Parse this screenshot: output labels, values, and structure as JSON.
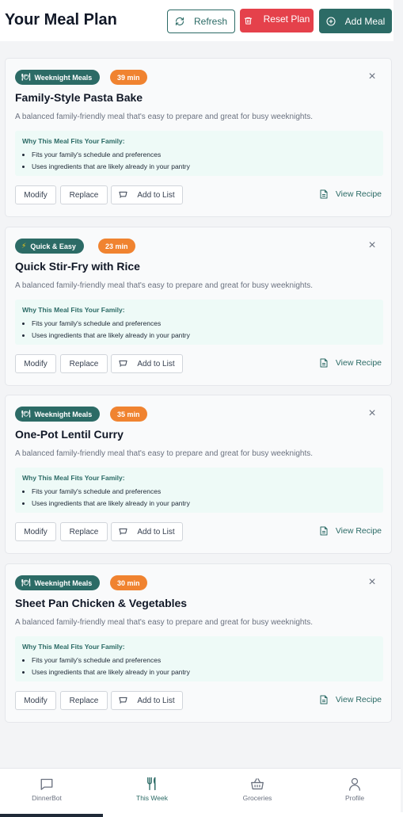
{
  "header": {
    "title": "Your Meal Plan",
    "refresh_label": "Refresh",
    "reset_label": "Reset Plan",
    "add_label": "Add Meal"
  },
  "colors": {
    "primary": "#2c6b66",
    "danger": "#e5414b",
    "time_badge": "#f08330",
    "why_bg": "#eefaf7"
  },
  "meals": [
    {
      "category": "Weeknight Meals",
      "category_icon": "plate-icon",
      "time": "39 min",
      "title": "Family-Style Pasta Bake",
      "description": "A balanced family-friendly meal that's easy to prepare and great for busy weeknights.",
      "why_title": "Why This Meal Fits Your Family:",
      "reasons": [
        "Fits your family's schedule and preferences",
        "Uses ingredients that are likely already in your pantry"
      ],
      "modify_label": "Modify",
      "replace_label": "Replace",
      "add_to_list_label": "Add to List",
      "view_recipe_label": "View Recipe"
    },
    {
      "category": "Quick & Easy",
      "category_icon": "lightning-icon",
      "time": "23 min",
      "title": "Quick Stir-Fry with Rice",
      "description": "A balanced family-friendly meal that's easy to prepare and great for busy weeknights.",
      "why_title": "Why This Meal Fits Your Family:",
      "reasons": [
        "Fits your family's schedule and preferences",
        "Uses ingredients that are likely already in your pantry"
      ],
      "modify_label": "Modify",
      "replace_label": "Replace",
      "add_to_list_label": "Add to List",
      "view_recipe_label": "View Recipe"
    },
    {
      "category": "Weeknight Meals",
      "category_icon": "plate-icon",
      "time": "35 min",
      "title": "One-Pot Lentil Curry",
      "description": "A balanced family-friendly meal that's easy to prepare and great for busy weeknights.",
      "why_title": "Why This Meal Fits Your Family:",
      "reasons": [
        "Fits your family's schedule and preferences",
        "Uses ingredients that are likely already in your pantry"
      ],
      "modify_label": "Modify",
      "replace_label": "Replace",
      "add_to_list_label": "Add to List",
      "view_recipe_label": "View Recipe"
    },
    {
      "category": "Weeknight Meals",
      "category_icon": "plate-icon",
      "time": "30 min",
      "title": "Sheet Pan Chicken & Vegetables",
      "description": "A balanced family-friendly meal that's easy to prepare and great for busy weeknights.",
      "why_title": "Why This Meal Fits Your Family:",
      "reasons": [
        "Fits your family's schedule and preferences",
        "Uses ingredients that are likely already in your pantry"
      ],
      "modify_label": "Modify",
      "replace_label": "Replace",
      "add_to_list_label": "Add to List",
      "view_recipe_label": "View Recipe"
    }
  ],
  "nav": {
    "items": [
      {
        "label": "DinnerBot",
        "icon": "chat-icon"
      },
      {
        "label": "This Week",
        "icon": "utensils-icon",
        "active": true
      },
      {
        "label": "Groceries",
        "icon": "basket-icon"
      },
      {
        "label": "Profile",
        "icon": "user-icon"
      }
    ]
  }
}
